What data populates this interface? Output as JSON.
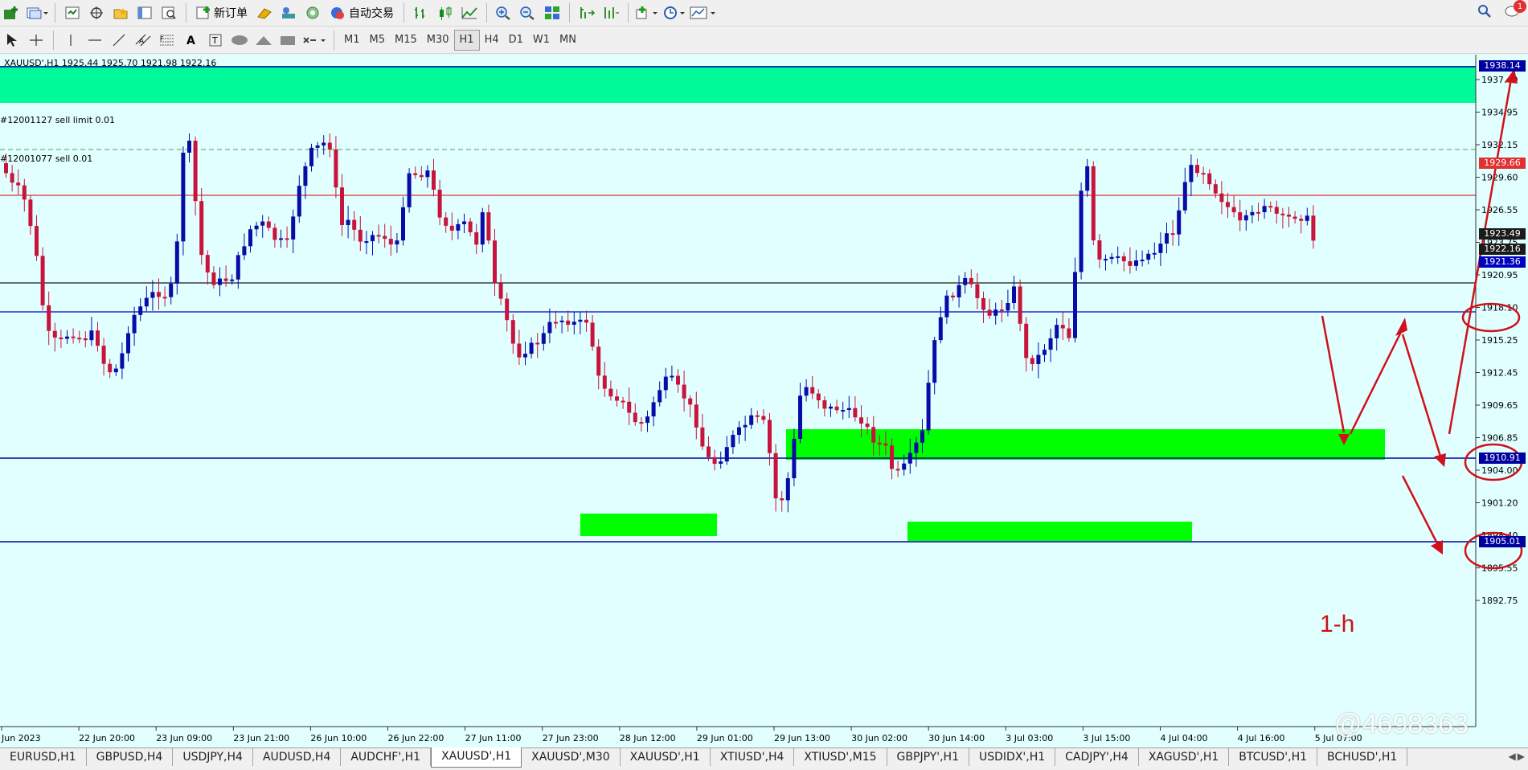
{
  "toolbar": {
    "new_order_label": "新订单",
    "auto_trading_label": "自动交易",
    "timeframes": [
      "M1",
      "M5",
      "M15",
      "M30",
      "H1",
      "H4",
      "D1",
      "W1",
      "MN"
    ],
    "active_timeframe": "H1",
    "notification_count": "1"
  },
  "chart": {
    "info": "XAUUSD',H1  1925.44 1925.70 1921.98 1922.16",
    "orders": [
      {
        "label": "#12001127 sell limit 0.01"
      },
      {
        "label": "#12001077 sell 0.01"
      }
    ],
    "price_tags": [
      {
        "text": "1938.14",
        "color": "#0000a0"
      },
      {
        "text": "1929.66",
        "color": "#e03030"
      },
      {
        "text": "1923.49",
        "color": "#1a1a1a"
      },
      {
        "text": "1922.16",
        "color": "#1a1a1a"
      },
      {
        "text": "1921.36",
        "color": "#0000c0"
      },
      {
        "text": "1910.91",
        "color": "#0000a0"
      },
      {
        "text": "1905.01",
        "color": "#0000a0"
      }
    ],
    "y_ticks": [
      "1937.40",
      "1934.95",
      "1932.15",
      "1929.60",
      "1926.55",
      "1923.75",
      "1920.95",
      "1918.10",
      "1915.25",
      "1912.45",
      "1909.65",
      "1906.85",
      "1904.00",
      "1901.20",
      "1898.40",
      "1895.55",
      "1892.75"
    ],
    "x_ticks": [
      "Jun 2023",
      "22 Jun 20:00",
      "23 Jun 09:00",
      "23 Jun 21:00",
      "26 Jun 10:00",
      "26 Jun 22:00",
      "27 Jun 11:00",
      "27 Jun 23:00",
      "28 Jun 12:00",
      "29 Jun 01:00",
      "29 Jun 13:00",
      "30 Jun 02:00",
      "30 Jun 14:00",
      "3 Jul 03:00",
      "3 Jul 15:00",
      "4 Jul 04:00",
      "4 Jul 16:00",
      "5 Jul 07:00"
    ],
    "annotation": "1-h",
    "watermark": "@4698363",
    "colors": {
      "background": "#e0fffe",
      "bull": "#0a0aa8",
      "bear": "#c8143c",
      "zone": "#00ff00",
      "top_zone": "#00fa9a",
      "arrow": "#d0101a"
    }
  },
  "tabs": [
    "EURUSD,H1",
    "GBPUSD,H4",
    "USDJPY,H4",
    "AUDUSD,H4",
    "AUDCHF',H1",
    "XAUUSD',H1",
    "XAUUSD',M30",
    "XAUUSD',H1",
    "XTIUSD',H4",
    "XTIUSD',M15",
    "GBPJPY',H1",
    "USDIDX',H1",
    "CADJPY',H4",
    "XAGUSD',H1",
    "BTCUSD',H1",
    "BCHUSD',H1"
  ],
  "active_tab": "XAUUSD',H1"
}
